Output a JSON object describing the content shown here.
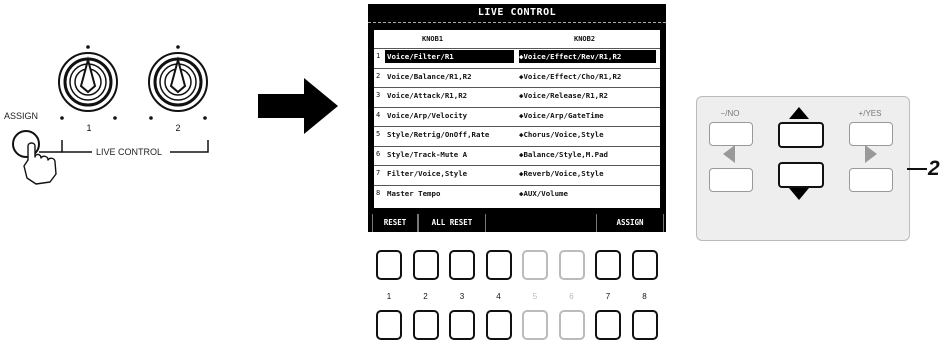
{
  "left": {
    "assign_label": "ASSIGN",
    "knob1_label": "1",
    "knob2_label": "2",
    "live_control_label": "LIVE CONTROL"
  },
  "lcd": {
    "title": "LIVE CONTROL",
    "col_knob1": "KNOB1",
    "col_knob2": "KNOB2",
    "rows": [
      {
        "num": "1",
        "k1": "Voice/Filter/R1",
        "k2": "◆Voice/Effect/Rev/R1,R2"
      },
      {
        "num": "2",
        "k1": "Voice/Balance/R1,R2",
        "k2": "◆Voice/Effect/Cho/R1,R2"
      },
      {
        "num": "3",
        "k1": "Voice/Attack/R1,R2",
        "k2": "◆Voice/Release/R1,R2"
      },
      {
        "num": "4",
        "k1": "Voice/Arp/Velocity",
        "k2": "◆Voice/Arp/GateTime"
      },
      {
        "num": "5",
        "k1": "Style/Retrig/OnOff,Rate",
        "k2": "◆Chorus/Voice,Style"
      },
      {
        "num": "6",
        "k1": "Style/Track-Mute A",
        "k2": "◆Balance/Style,M.Pad"
      },
      {
        "num": "7",
        "k1": "Filter/Voice,Style",
        "k2": "◆Reverb/Voice,Style"
      },
      {
        "num": "8",
        "k1": "Master Tempo",
        "k2": "◆AUX/Volume"
      }
    ],
    "buttons": {
      "reset": "RESET",
      "all_reset": "ALL RESET",
      "assign": "ASSIGN"
    }
  },
  "keys": {
    "numbers": [
      "1",
      "2",
      "3",
      "4",
      "5",
      "6",
      "7",
      "8"
    ]
  },
  "panel": {
    "no_label": "−/NO",
    "yes_label": "+/YES"
  },
  "callout": "2"
}
